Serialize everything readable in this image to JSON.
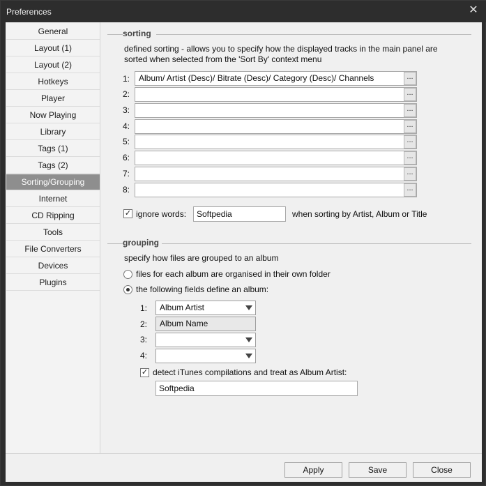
{
  "window": {
    "title": "Preferences",
    "close_glyph": "✕"
  },
  "sidebar": {
    "items": [
      {
        "label": "General"
      },
      {
        "label": "Layout (1)"
      },
      {
        "label": "Layout (2)"
      },
      {
        "label": "Hotkeys"
      },
      {
        "label": "Player"
      },
      {
        "label": "Now Playing"
      },
      {
        "label": "Library"
      },
      {
        "label": "Tags (1)"
      },
      {
        "label": "Tags (2)"
      },
      {
        "label": "Sorting/Grouping",
        "active": true
      },
      {
        "label": "Internet"
      },
      {
        "label": "CD Ripping"
      },
      {
        "label": "Tools"
      },
      {
        "label": "File Converters"
      },
      {
        "label": "Devices"
      },
      {
        "label": "Plugins"
      }
    ]
  },
  "sorting": {
    "title": "sorting",
    "description_line1": "defined sorting - allows you to specify how the displayed tracks in the main panel are",
    "description_line2": "sorted when selected from the 'Sort By' context menu",
    "rows": [
      {
        "num": "1:",
        "value": "Album/ Artist (Desc)/ Bitrate (Desc)/ Category (Desc)/ Channels"
      },
      {
        "num": "2:",
        "value": ""
      },
      {
        "num": "3:",
        "value": ""
      },
      {
        "num": "4:",
        "value": ""
      },
      {
        "num": "5:",
        "value": ""
      },
      {
        "num": "6:",
        "value": ""
      },
      {
        "num": "7:",
        "value": ""
      },
      {
        "num": "8:",
        "value": ""
      }
    ],
    "dots_label": "...",
    "ignore_words_label": "ignore words:",
    "ignore_words_value": "Softpedia",
    "ignore_words_suffix": "when sorting by Artist, Album or Title",
    "ignore_words_checked": true
  },
  "grouping": {
    "title": "grouping",
    "description": "specify how files are grouped to an album",
    "option1_label": "files for each album are organised in their own folder",
    "option2_label": "the following fields define an album:",
    "selected_option": 2,
    "fields": [
      {
        "num": "1:",
        "value": "Album Artist",
        "enabled": true
      },
      {
        "num": "2:",
        "value": "Album Name",
        "enabled": false
      },
      {
        "num": "3:",
        "value": "",
        "enabled": true
      },
      {
        "num": "4:",
        "value": "",
        "enabled": true
      }
    ],
    "itunes_label": "detect iTunes compilations and treat as Album Artist:",
    "itunes_checked": true,
    "itunes_value": "Softpedia"
  },
  "footer": {
    "apply": "Apply",
    "save": "Save",
    "close": "Close"
  },
  "icons": {
    "checkmark": "✓"
  }
}
